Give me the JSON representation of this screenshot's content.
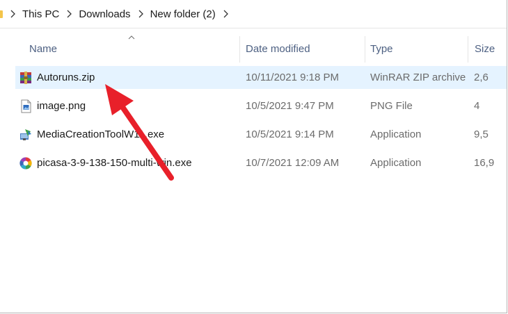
{
  "breadcrumb": {
    "items": [
      "This PC",
      "Downloads",
      "New folder (2)"
    ]
  },
  "columns": {
    "name": "Name",
    "date": "Date modified",
    "type": "Type",
    "size": "Size"
  },
  "files": [
    {
      "name": "Autoruns.zip",
      "date": "10/11/2021 9:18 PM",
      "type": "WinRAR ZIP archive",
      "size": "2,6",
      "icon": "winrar-archive-icon",
      "selected": true
    },
    {
      "name": "image.png",
      "date": "10/5/2021 9:47 PM",
      "type": "PNG File",
      "size": "4",
      "icon": "png-file-icon",
      "selected": false
    },
    {
      "name": "MediaCreationToolW11.exe",
      "date": "10/5/2021 9:14 PM",
      "type": "Application",
      "size": "9,5",
      "icon": "media-creation-tool-icon",
      "selected": false
    },
    {
      "name": "picasa-3-9-138-150-multi-win.exe",
      "date": "10/7/2021 12:09 AM",
      "type": "Application",
      "size": "16,9",
      "icon": "picasa-icon",
      "selected": false
    }
  ],
  "colors": {
    "selection": "#e5f3ff",
    "annotation_arrow": "#e8202a",
    "header_text": "#4d6082"
  }
}
